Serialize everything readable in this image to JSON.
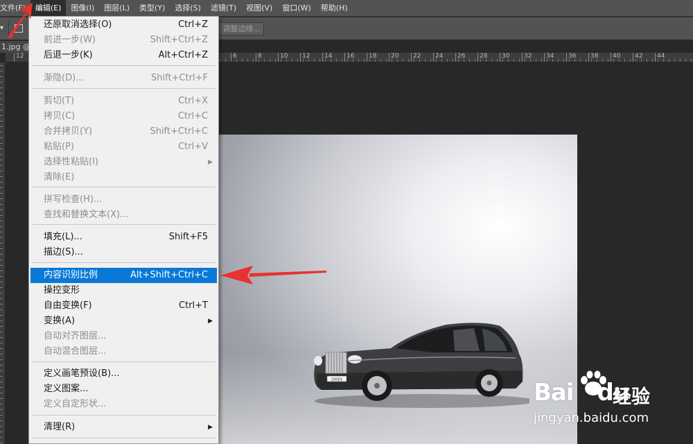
{
  "menubar": {
    "items": [
      "文件(F)",
      "编辑(E)",
      "图像(I)",
      "图层(L)",
      "类型(Y)",
      "选择(S)",
      "滤镜(T)",
      "视图(V)",
      "窗口(W)",
      "帮助(H)"
    ],
    "active_index": 1
  },
  "options_bar": {
    "refine_edge_label": "调整边缘..."
  },
  "document_tab": {
    "label": "1.jpg @"
  },
  "ruler": {
    "labels": [
      "12",
      "6",
      "8",
      "10",
      "12",
      "14",
      "16",
      "18",
      "20",
      "22",
      "24",
      "26",
      "28",
      "30",
      "32",
      "34",
      "36",
      "38",
      "40",
      "42",
      "44"
    ]
  },
  "edit_menu": {
    "items": [
      {
        "label": "还原取消选择(O)",
        "shortcut": "Ctrl+Z",
        "state": "enabled"
      },
      {
        "label": "前进一步(W)",
        "shortcut": "Shift+Ctrl+Z",
        "state": "disabled"
      },
      {
        "label": "后退一步(K)",
        "shortcut": "Alt+Ctrl+Z",
        "state": "enabled"
      },
      {
        "label": "渐隐(D)...",
        "shortcut": "Shift+Ctrl+F",
        "state": "disabled"
      },
      {
        "label": "剪切(T)",
        "shortcut": "Ctrl+X",
        "state": "disabled"
      },
      {
        "label": "拷贝(C)",
        "shortcut": "Ctrl+C",
        "state": "disabled"
      },
      {
        "label": "合并拷贝(Y)",
        "shortcut": "Shift+Ctrl+C",
        "state": "disabled"
      },
      {
        "label": "粘贴(P)",
        "shortcut": "Ctrl+V",
        "state": "disabled"
      },
      {
        "label": "选择性粘贴(I)",
        "shortcut": "",
        "state": "disabled",
        "submenu": true
      },
      {
        "label": "清除(E)",
        "shortcut": "",
        "state": "disabled"
      },
      {
        "label": "拼写检查(H)...",
        "shortcut": "",
        "state": "disabled"
      },
      {
        "label": "查找和替换文本(X)...",
        "shortcut": "",
        "state": "disabled"
      },
      {
        "label": "填充(L)...",
        "shortcut": "Shift+F5",
        "state": "enabled"
      },
      {
        "label": "描边(S)...",
        "shortcut": "",
        "state": "enabled"
      },
      {
        "label": "内容识别比例",
        "shortcut": "Alt+Shift+Ctrl+C",
        "state": "highlighted"
      },
      {
        "label": "操控变形",
        "shortcut": "",
        "state": "enabled"
      },
      {
        "label": "自由变换(F)",
        "shortcut": "Ctrl+T",
        "state": "enabled"
      },
      {
        "label": "变换(A)",
        "shortcut": "",
        "state": "enabled",
        "submenu": true
      },
      {
        "label": "自动对齐图层...",
        "shortcut": "",
        "state": "disabled"
      },
      {
        "label": "自动混合图层...",
        "shortcut": "",
        "state": "disabled"
      },
      {
        "label": "定义画笔预设(B)...",
        "shortcut": "",
        "state": "enabled"
      },
      {
        "label": "定义图案...",
        "shortcut": "",
        "state": "enabled"
      },
      {
        "label": "定义自定形状...",
        "shortcut": "",
        "state": "disabled"
      },
      {
        "label": "清理(R)",
        "shortcut": "",
        "state": "enabled",
        "submenu": true
      }
    ],
    "submenu_glyph": "▶"
  },
  "car_plate": "200EX",
  "watermark": {
    "logo": "Bai",
    "logo_suffix": "du",
    "text": "经验",
    "url": "jingyan.baidu.com"
  },
  "colors": {
    "highlight": "#0a78d6",
    "annotation": "#e8322f",
    "menubar_bg": "#535353",
    "menu_bg": "#f0f0f0"
  },
  "icons": [
    "dropdown-arrow-icon",
    "rect-marquee-icon",
    "submenu-arrow-icon",
    "baidu-paw-icon"
  ]
}
